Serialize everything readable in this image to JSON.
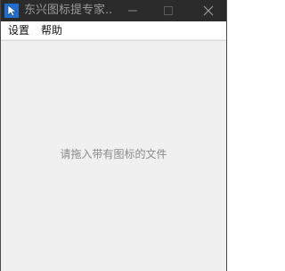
{
  "window": {
    "title": "东兴图标提专家...",
    "icon": "app-cursor-icon",
    "buttons": {
      "minimize_icon": "minimize-icon",
      "maximize_icon": "maximize-icon",
      "close_icon": "close-icon"
    }
  },
  "menubar": {
    "items": [
      {
        "label": "设置"
      },
      {
        "label": "帮助"
      }
    ]
  },
  "client": {
    "hint": "请拖入带有图标的文件"
  },
  "colors": {
    "titlebar": "#2b2b2b",
    "title_text": "#9a9a9a",
    "client_bg": "#f0f0f0",
    "hint_text": "#8a8a8a"
  }
}
